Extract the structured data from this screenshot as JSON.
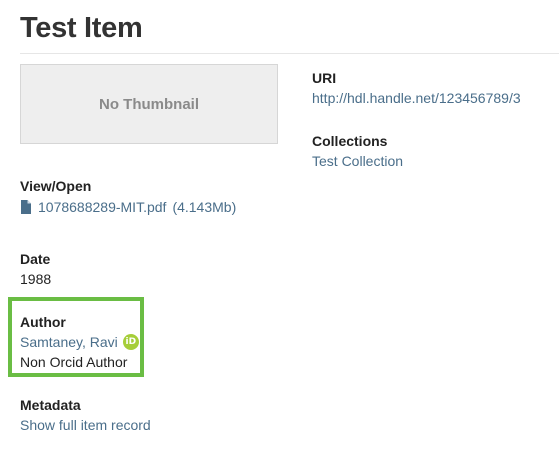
{
  "item": {
    "title": "Test Item",
    "thumbnail_label": "No Thumbnail"
  },
  "uri": {
    "heading": "URI",
    "link": "http://hdl.handle.net/123456789/3"
  },
  "collections": {
    "heading": "Collections",
    "link": "Test Collection"
  },
  "files": {
    "heading": "View/Open",
    "file_name": "1078688289-MIT.pdf",
    "file_size": "(4.143Mb)",
    "icon": "file-icon"
  },
  "date": {
    "heading": "Date",
    "value": "1988"
  },
  "author": {
    "heading": "Author",
    "orcid_author": "Samtaney, Ravi",
    "orcid_badge": "iD",
    "plain_author": "Non Orcid Author",
    "highlight_color": "#6abd44",
    "orcid_color": "#a6ce39"
  },
  "metadata": {
    "heading": "Metadata",
    "link": "Show full item record"
  },
  "colors": {
    "link": "#4a6e8a",
    "text": "#222222"
  }
}
